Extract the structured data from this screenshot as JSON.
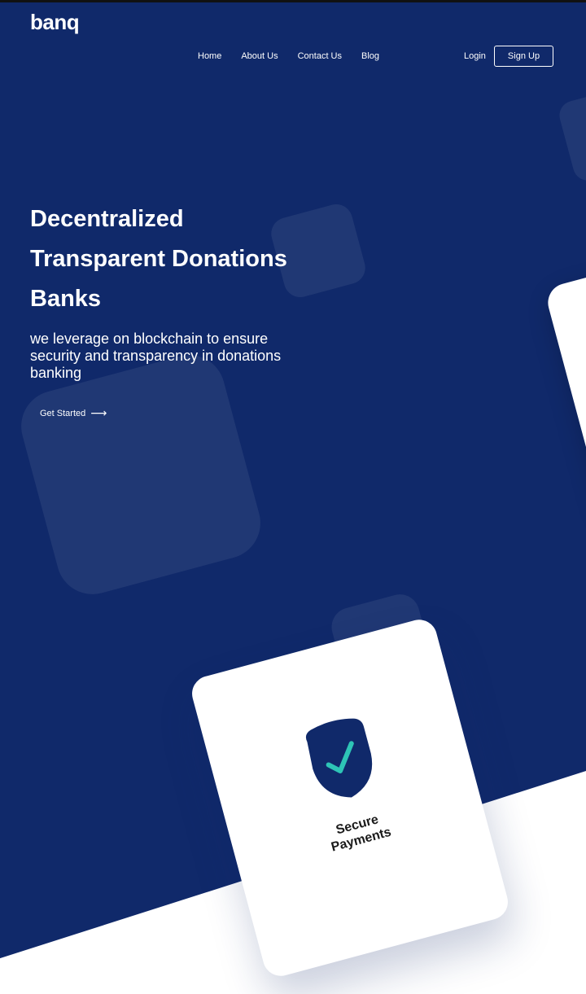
{
  "brand": {
    "logo": "banq"
  },
  "nav": {
    "items": [
      {
        "label": "Home"
      },
      {
        "label": "About Us"
      },
      {
        "label": "Contact Us"
      },
      {
        "label": "Blog"
      }
    ],
    "login": "Login",
    "signup": "Sign Up"
  },
  "hero": {
    "title_lines": [
      "Decentralized",
      "Transparent Donations",
      "Banks"
    ],
    "subtitle": "we leverage on blockchain to ensure security and transparency in donations banking",
    "cta": "Get Started",
    "cta_arrow": "⟶"
  },
  "feature_card": {
    "label_lines": [
      "Secure",
      "Payments"
    ],
    "icon": "shield-check-icon"
  },
  "colors": {
    "hero_bg": "#10296a",
    "accent_check": "#2ec4b6",
    "text_light": "#ffffff"
  }
}
